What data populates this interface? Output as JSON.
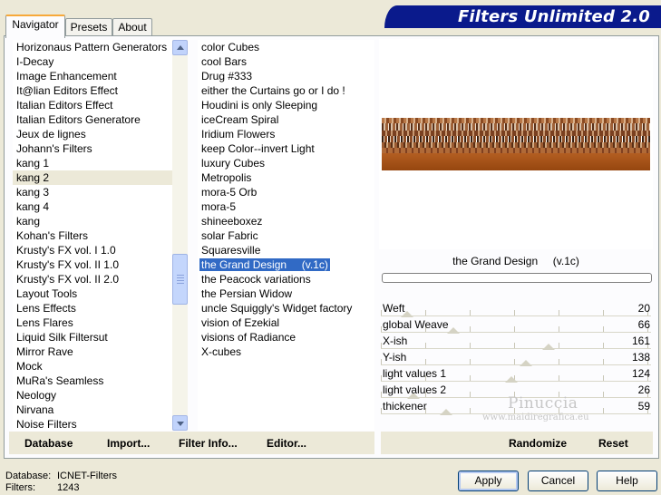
{
  "tabs": [
    {
      "label": "Navigator",
      "active": true
    },
    {
      "label": "Presets",
      "active": false
    },
    {
      "label": "About",
      "active": false
    }
  ],
  "banner_title": "Filters Unlimited 2.0",
  "categories": [
    "Horizonaus Pattern Generators",
    "I-Decay",
    "Image Enhancement",
    "It@lian Editors Effect",
    "Italian Editors Effect",
    "Italian Editors Generatore",
    "Jeux de lignes",
    "Johann's Filters",
    "kang 1",
    "kang 2",
    "kang 3",
    "kang 4",
    "kang",
    "Kohan's Filters",
    "Krusty's FX vol. I 1.0",
    "Krusty's FX vol. II 1.0",
    "Krusty's FX vol. II 2.0",
    "Layout Tools",
    "Lens Effects",
    "Lens Flares",
    "Liquid Silk Filtersut",
    "Mirror Rave",
    "Mock",
    "MuRa's Seamless",
    "Neology",
    "Nirvana",
    "Noise Filters"
  ],
  "selected_category": "kang 2",
  "filters": [
    "color Cubes",
    "cool Bars",
    "Drug #333",
    "either the Curtains go or I do !",
    "Houdini is only Sleeping",
    "iceCream Spiral",
    "Iridium Flowers",
    "keep Color--invert Light",
    "luxury Cubes",
    "Metropolis",
    "mora-5 Orb",
    "mora-5",
    "shineeboxez",
    "solar Fabric",
    "Squaresville",
    "the Grand Design     (v.1c)",
    "the Peacock variations",
    "the Persian Widow",
    "uncle Squiggly's Widget factory",
    "vision of Ezekial",
    "visions of Radiance",
    "X-cubes"
  ],
  "selected_filter": "the Grand Design     (v.1c)",
  "current_filter_name": "the Grand Design     (v.1c)",
  "progress": 0,
  "parameters": [
    {
      "label": "Weft",
      "value": "20"
    },
    {
      "label": "global Weave",
      "value": "66"
    },
    {
      "label": "X-ish",
      "value": "161"
    },
    {
      "label": "Y-ish",
      "value": "138"
    },
    {
      "label": "light values 1",
      "value": "124"
    },
    {
      "label": "light values 2",
      "value": "26"
    },
    {
      "label": "thickener",
      "value": "59"
    }
  ],
  "left_buttons": {
    "database": "Database",
    "import": "Import...",
    "filter_info": "Filter Info...",
    "editor": "Editor..."
  },
  "right_buttons": {
    "randomize": "Randomize",
    "reset": "Reset"
  },
  "watermark": {
    "name": "Pinuccia",
    "url": "www.maidiregrafica.eu"
  },
  "status": {
    "database_label": "Database:",
    "database_value": "ICNET-Filters",
    "filters_label": "Filters:",
    "filters_value": "1243"
  },
  "dialog_buttons": {
    "apply": "Apply",
    "cancel": "Cancel",
    "help": "Help"
  },
  "colors": {
    "accent": "#316ac5",
    "banner": "#0a1a8c",
    "pattern_brown": "#a2521c"
  }
}
